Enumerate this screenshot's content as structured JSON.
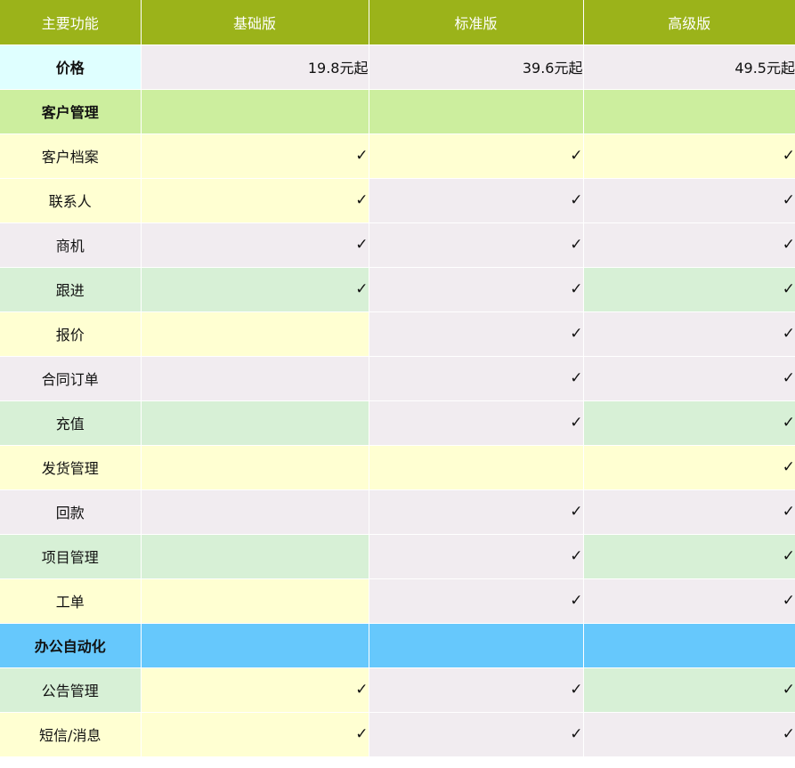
{
  "header": {
    "feature": "主要功能",
    "plans": [
      "基础版",
      "标准版",
      "高级版"
    ]
  },
  "price": {
    "label": "价格",
    "values": [
      "19.8元起",
      "39.6元起",
      "49.5元起"
    ]
  },
  "check_mark": "✓",
  "sections": [
    {
      "title": "客户管理",
      "rows": [
        {
          "name": "客户档案",
          "plans": [
            true,
            true,
            true
          ]
        },
        {
          "name": "联系人",
          "plans": [
            true,
            true,
            true
          ]
        },
        {
          "name": "商机",
          "plans": [
            true,
            true,
            true
          ]
        },
        {
          "name": "跟进",
          "plans": [
            true,
            true,
            true
          ]
        },
        {
          "name": "报价",
          "plans": [
            false,
            true,
            true
          ]
        },
        {
          "name": "合同订单",
          "plans": [
            false,
            true,
            true
          ]
        },
        {
          "name": "充值",
          "plans": [
            false,
            true,
            true
          ]
        },
        {
          "name": "发货管理",
          "plans": [
            false,
            false,
            true
          ]
        },
        {
          "name": "回款",
          "plans": [
            false,
            true,
            true
          ]
        },
        {
          "name": "项目管理",
          "plans": [
            false,
            true,
            true
          ]
        },
        {
          "name": "工单",
          "plans": [
            false,
            true,
            true
          ]
        }
      ]
    },
    {
      "title": "办公自动化",
      "rows": [
        {
          "name": "公告管理",
          "plans": [
            true,
            true,
            true
          ]
        },
        {
          "name": "短信/消息",
          "plans": [
            true,
            true,
            true
          ]
        }
      ]
    }
  ],
  "colors": {
    "header": "#9bb31a",
    "price_label": "#dfffff",
    "section_customer": "#ccee9e",
    "section_office": "#66c8fc",
    "yellow": "#ffffd2",
    "gray": "#f1ecf0",
    "green": "#d7f0d6"
  }
}
